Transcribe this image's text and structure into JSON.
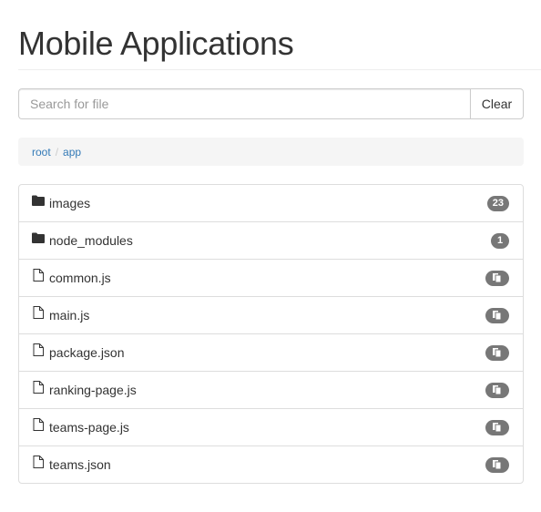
{
  "header": {
    "title": "Mobile Applications"
  },
  "search": {
    "placeholder": "Search for file",
    "value": "",
    "clear_label": "Clear"
  },
  "breadcrumb": {
    "items": [
      "root",
      "app"
    ]
  },
  "files": [
    {
      "name": "images",
      "type": "folder",
      "badge": "23"
    },
    {
      "name": "node_modules",
      "type": "folder",
      "badge": "1"
    },
    {
      "name": "common.js",
      "type": "file",
      "badge_icon": "copy-icon"
    },
    {
      "name": "main.js",
      "type": "file",
      "badge_icon": "copy-icon"
    },
    {
      "name": "package.json",
      "type": "file",
      "badge_icon": "copy-icon"
    },
    {
      "name": "ranking-page.js",
      "type": "file",
      "badge_icon": "copy-icon"
    },
    {
      "name": "teams-page.js",
      "type": "file",
      "badge_icon": "copy-icon"
    },
    {
      "name": "teams.json",
      "type": "file",
      "badge_icon": "copy-icon"
    }
  ],
  "colors": {
    "link": "#337ab7",
    "badge": "#777777",
    "border": "#dddddd",
    "breadcrumb_bg": "#f5f5f5"
  }
}
